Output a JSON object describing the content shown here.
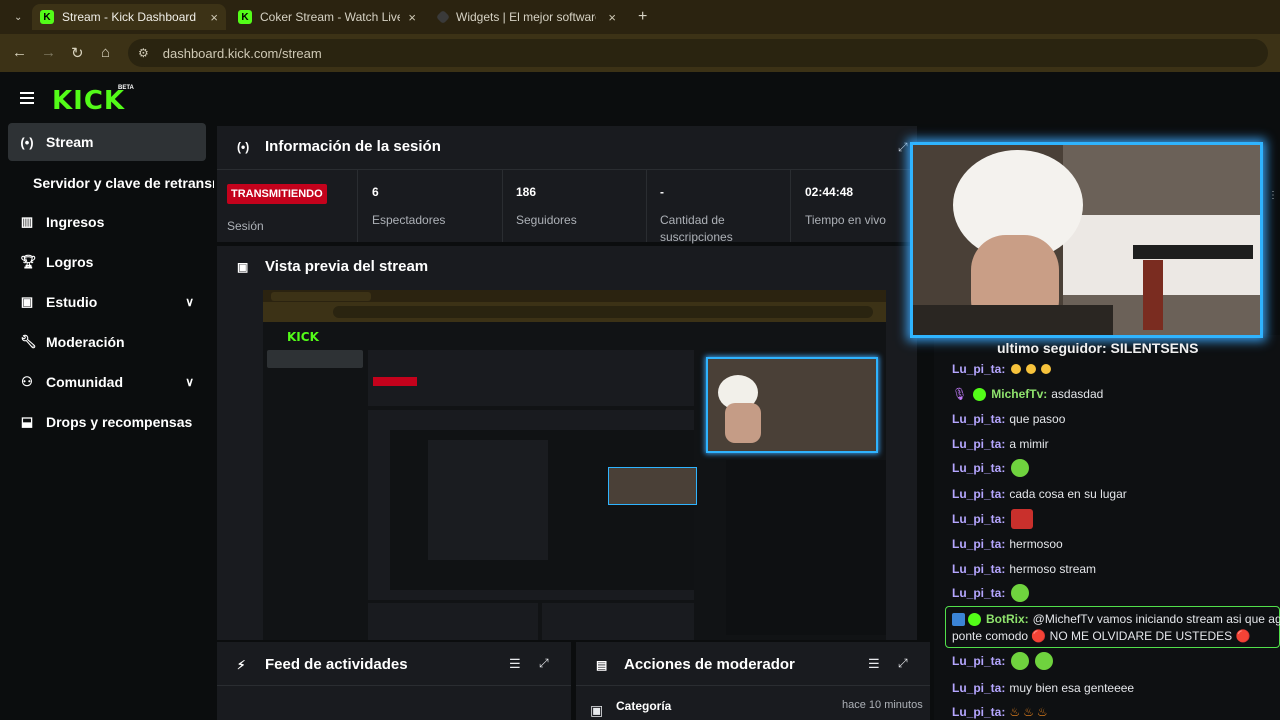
{
  "browser": {
    "tabs": [
      {
        "title": "Stream - Kick Dashboard",
        "active": true
      },
      {
        "title": "Coker Stream - Watch Live on K",
        "active": false
      },
      {
        "title": "Widgets | El mejor software par",
        "active": false
      }
    ],
    "new_tab": "+",
    "close": "×",
    "url": "dashboard.kick.com/stream"
  },
  "app": {
    "logo": "KICK",
    "logo_badge": "BETA",
    "accent": "#53fc18"
  },
  "sidebar": {
    "items": [
      {
        "label": "Stream",
        "icon": "broadcast-icon"
      },
      {
        "label": "Servidor y clave de retransmisión",
        "icon": ""
      },
      {
        "label": "Ingresos",
        "icon": "chart-icon"
      },
      {
        "label": "Logros",
        "icon": "trophy-icon"
      },
      {
        "label": "Estudio",
        "icon": "studio-icon"
      },
      {
        "label": "Moderación",
        "icon": "wrench-icon"
      },
      {
        "label": "Comunidad",
        "icon": "community-icon"
      },
      {
        "label": "Drops y recompensas",
        "icon": "drops-icon"
      }
    ]
  },
  "session": {
    "title": "Información de la sesión",
    "status_badge": "TRANSMITIENDO",
    "status_label": "Sesión",
    "stats": [
      {
        "value": "6",
        "label": "Espectadores"
      },
      {
        "value": "186",
        "label": "Seguidores"
      },
      {
        "value": "-",
        "label": "Cantidad de suscripciones"
      },
      {
        "value": "02:44:48",
        "label": "Tiempo en vivo"
      }
    ]
  },
  "preview": {
    "title": "Vista previa del stream"
  },
  "feed": {
    "title": "Feed de actividades"
  },
  "modactions": {
    "title": "Acciones de moderador",
    "row_title": "Categoría",
    "row_time": "hace 10 minutos"
  },
  "overlay": {
    "follower_text": "ultimo seguidor: SILENTSENS"
  },
  "chat": {
    "messages": [
      {
        "user": "Lu_pi_ta:",
        "text": ""
      },
      {
        "user": "MichefTv:",
        "text": "asdasdad"
      },
      {
        "user": "Lu_pi_ta:",
        "text": "que pasoo"
      },
      {
        "user": "Lu_pi_ta:",
        "text": "a mimir"
      },
      {
        "user": "Lu_pi_ta:",
        "text": ""
      },
      {
        "user": "Lu_pi_ta:",
        "text": "cada cosa en su lugar"
      },
      {
        "user": "Lu_pi_ta:",
        "text": ""
      },
      {
        "user": "Lu_pi_ta:",
        "text": "hermosoo"
      },
      {
        "user": "Lu_pi_ta:",
        "text": "hermoso stream"
      },
      {
        "user": "Lu_pi_ta:",
        "text": ""
      },
      {
        "user": "Lu_pi_ta:",
        "text": ""
      },
      {
        "user": "Lu_pi_ta:",
        "text": "muy bien esa genteeee"
      },
      {
        "user": "Lu_pi_ta:",
        "text": ""
      }
    ],
    "bot": {
      "user": "BotRix:",
      "line1": "@MichefTv vamos iniciando stream asi que agarr",
      "line2": "ponte comodo 🔴 NO ME OLVIDARE DE USTEDES 🔴"
    }
  }
}
